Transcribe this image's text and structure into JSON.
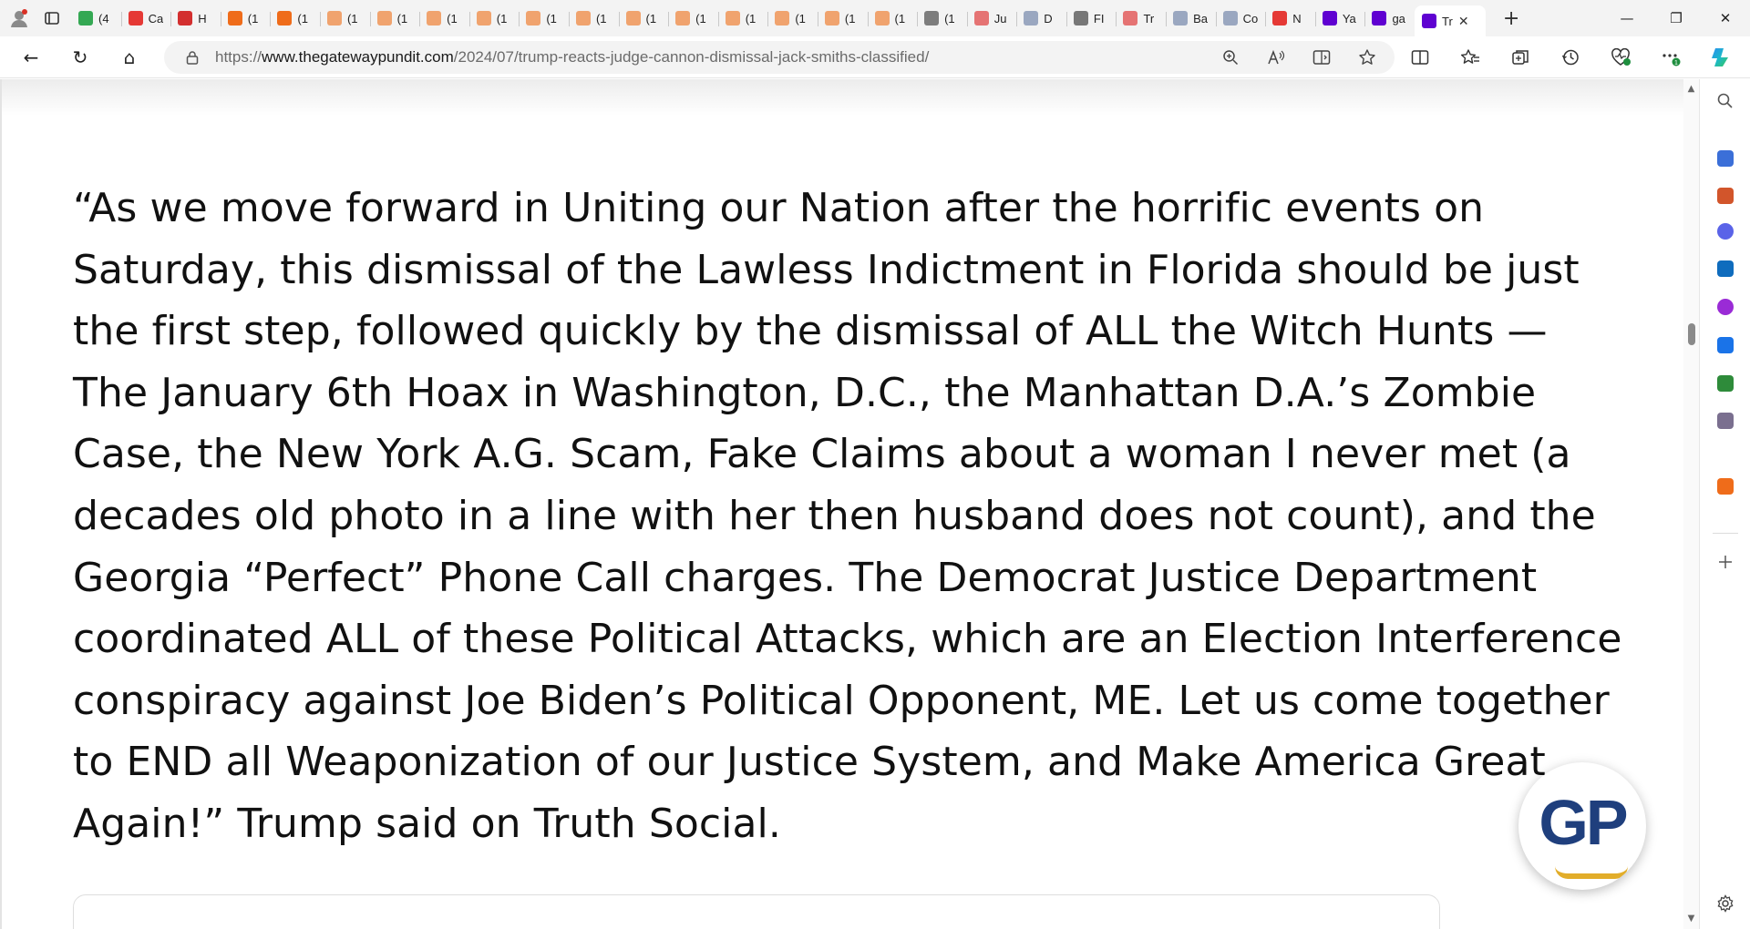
{
  "browser": {
    "tabs": [
      {
        "title": "",
        "favicon": "profile-avatar-icon",
        "color": "#888888"
      },
      {
        "title": "",
        "favicon": "tab-actions-icon",
        "color": "#333333"
      },
      {
        "title": "(4",
        "favicon": "g-green-icon",
        "color": "#34a853"
      },
      {
        "title": "Ca",
        "favicon": "youtube-icon",
        "color": "#e53935"
      },
      {
        "title": "H",
        "favicon": "bell-red-icon",
        "color": "#d32f2f"
      },
      {
        "title": "(1",
        "favicon": "bookmark-orange-icon",
        "color": "#ef6c1a"
      },
      {
        "title": "(1",
        "favicon": "bookmark-orange-icon",
        "color": "#ef6c1a"
      },
      {
        "title": "(1",
        "favicon": "bookmark-faded-icon",
        "color": "#f0a36e"
      },
      {
        "title": "(1",
        "favicon": "bookmark-faded-icon",
        "color": "#f0a36e"
      },
      {
        "title": "(1",
        "favicon": "bookmark-faded-icon",
        "color": "#f0a36e"
      },
      {
        "title": "(1",
        "favicon": "bookmark-faded-icon",
        "color": "#f0a36e"
      },
      {
        "title": "(1",
        "favicon": "bookmark-faded-icon",
        "color": "#f0a36e"
      },
      {
        "title": "(1",
        "favicon": "bookmark-faded-icon",
        "color": "#f0a36e"
      },
      {
        "title": "(1",
        "favicon": "bookmark-faded-icon",
        "color": "#f0a36e"
      },
      {
        "title": "(1",
        "favicon": "bookmark-faded-icon",
        "color": "#f0a36e"
      },
      {
        "title": "(1",
        "favicon": "bookmark-faded-icon",
        "color": "#f0a36e"
      },
      {
        "title": "(1",
        "favicon": "bookmark-faded-icon",
        "color": "#f0a36e"
      },
      {
        "title": "(1",
        "favicon": "bookmark-faded-icon",
        "color": "#f0a36e"
      },
      {
        "title": "(1",
        "favicon": "bookmark-faded-icon",
        "color": "#f0a36e"
      },
      {
        "title": "(1",
        "favicon": "photo-icon",
        "color": "#7d7d7d"
      },
      {
        "title": "Ju",
        "favicon": "youtube-icon",
        "color": "#e57373"
      },
      {
        "title": "D",
        "favicon": "shield-icon",
        "color": "#9aa7c0"
      },
      {
        "title": "FI",
        "favicon": "document-icon",
        "color": "#777777"
      },
      {
        "title": "Tr",
        "favicon": "youtube-icon",
        "color": "#e57373"
      },
      {
        "title": "Ba",
        "favicon": "shield-icon",
        "color": "#9aa7c0"
      },
      {
        "title": "Co",
        "favicon": "shield-icon",
        "color": "#9aa7c0"
      },
      {
        "title": "N",
        "favicon": "r-red-icon",
        "color": "#e53935"
      },
      {
        "title": "Ya",
        "favicon": "yahoo-icon",
        "color": "#5f01d1"
      },
      {
        "title": "ga",
        "favicon": "yahoo-icon",
        "color": "#5f01d1"
      }
    ],
    "active_tab": {
      "title": "Tr",
      "close_glyph": "✕"
    },
    "new_tab_glyph": "+",
    "window_controls": {
      "minimize": "—",
      "restore": "❐",
      "close": "✕"
    },
    "address": {
      "scheme": "https://",
      "host": "www.thegatewaypundit.com",
      "path": "/2024/07/trump-reacts-judge-cannon-dismissal-jack-smiths-classified/"
    },
    "nav_glyphs": {
      "back": "←",
      "refresh": "↻",
      "home": "⌂"
    },
    "omnibox_icons": [
      "zoom-icon",
      "read-aloud-icon",
      "immersive-reader-icon",
      "favorite-star-icon"
    ],
    "toolbar_icons": [
      "split-screen-icon",
      "favorites-icon",
      "collections-icon",
      "history-icon",
      "performance-icon",
      "more-icon",
      "copilot-icon"
    ],
    "sidebar_icons": [
      {
        "name": "search-icon",
        "color": "#555555"
      },
      {
        "name": "tag-icon",
        "color": "#3b6fd8"
      },
      {
        "name": "briefcase-icon",
        "color": "#d2552b"
      },
      {
        "name": "m365-icon",
        "color": "#5a63e8"
      },
      {
        "name": "outlook-icon",
        "color": "#0f6cbd"
      },
      {
        "name": "drop-icon",
        "color": "#9a2bd6"
      },
      {
        "name": "send-icon",
        "color": "#1a73e8"
      },
      {
        "name": "tree-icon",
        "color": "#2e8b3a"
      },
      {
        "name": "games-icon",
        "color": "#7a6f8f"
      },
      {
        "name": "bookmark-icon",
        "color": "#ef6c1a"
      },
      {
        "name": "add-icon",
        "color": "#555555"
      }
    ],
    "settings_icon": "gear-icon"
  },
  "article": {
    "quote": "“As we move forward in Uniting our Nation after the horrific events on Saturday, this dismissal of the Lawless Indictment in Florida should be just the first step, followed quickly by the dismissal of ALL the Witch Hunts — The January 6th Hoax in Washington, D.C., the Manhattan D.A.’s Zombie Case, the New York A.G. Scam, Fake Claims about a woman I never met (a decades old photo in a line with her then husband does not count), and the Georgia “Perfect” Phone Call charges. The Democrat Justice Department coordinated ALL of these Political Attacks, which are an Election Interference conspiracy against Joe Biden’s Political Opponent, ME. Let us come together to END all Weaponization of our Justice System, and Make America Great Again!” Trump said on Truth Social."
  },
  "badge": {
    "text": "GP",
    "brand_color": "#1f3f7d",
    "accent_color": "#e2ad2a"
  }
}
